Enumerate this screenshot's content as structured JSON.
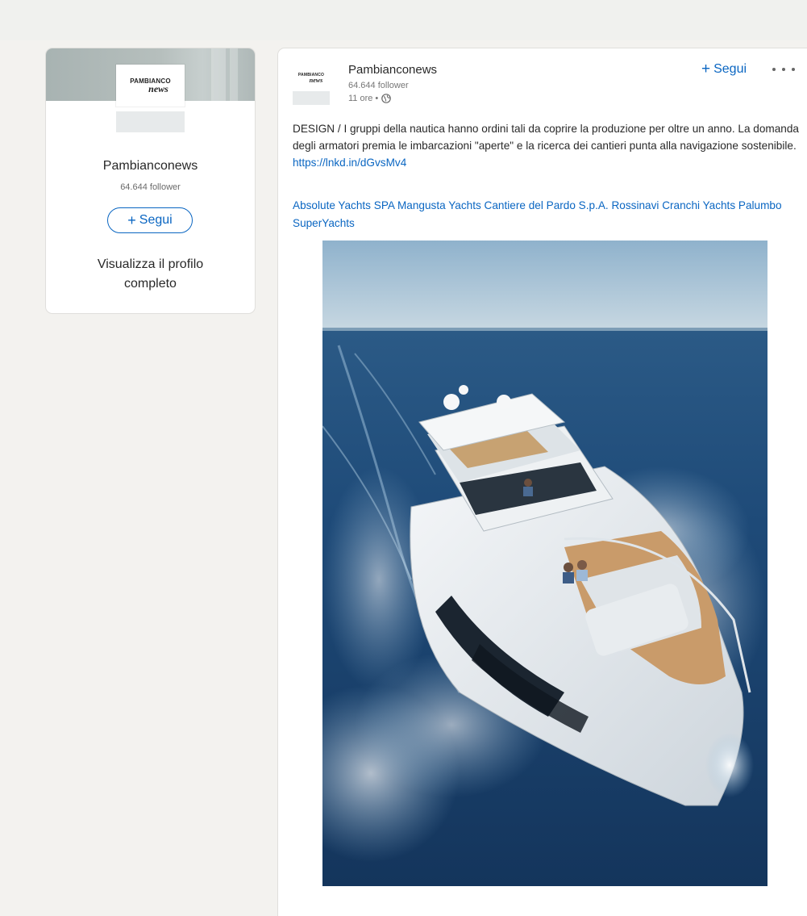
{
  "profile_card": {
    "logo_line1": "PAMBIANCO",
    "logo_line2": "news",
    "name": "Pambianconews",
    "followers": "64.644 follower",
    "follow_label": "Segui",
    "view_profile_label": "Visualizza il profilo completo"
  },
  "post": {
    "author": "Pambianconews",
    "followers": "64.644 follower",
    "time": "11 ore",
    "follow_label": "Segui",
    "body": "DESIGN / I gruppi della nautica hanno ordini tali da coprire la produzione per oltre un anno. La domanda degli armatori premia le imbarcazioni \"aperte\" e la ricerca dei cantieri punta alla navigazione sostenibile. ",
    "link": "https://lnkd.in/dGvsMv4",
    "tags": [
      "Absolute Yachts SPA",
      "Mangusta Yachts",
      "Cantiere del Pardo S.p.A.",
      "Rossinavi",
      "Cranchi Yachts",
      "Palumbo SuperYachts"
    ]
  },
  "colors": {
    "accent": "#0a66c2",
    "page_background": "#f3f2ef"
  },
  "icons": {
    "plus": "+",
    "globe": "globe-icon",
    "more": "more-icon"
  }
}
